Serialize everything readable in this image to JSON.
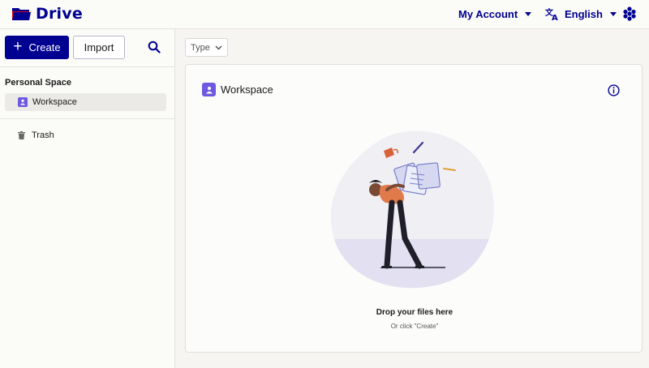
{
  "app": {
    "title": "Drive"
  },
  "header": {
    "account_label": "My Account",
    "language_label": "English"
  },
  "sidebar": {
    "create_label": "Create",
    "import_label": "Import",
    "section_title": "Personal Space",
    "items": [
      {
        "label": "Workspace",
        "icon": "workspace-icon",
        "selected": true
      },
      {
        "label": "Trash",
        "icon": "trash-icon",
        "selected": false
      }
    ]
  },
  "filters": {
    "type_label": "Type"
  },
  "panel": {
    "title": "Workspace",
    "drop_title": "Drop your files here",
    "drop_hint": "Or click \"Create\""
  },
  "colors": {
    "brand": "#000091",
    "accent": "#6e59e0",
    "shirt": "#e07a4a"
  }
}
